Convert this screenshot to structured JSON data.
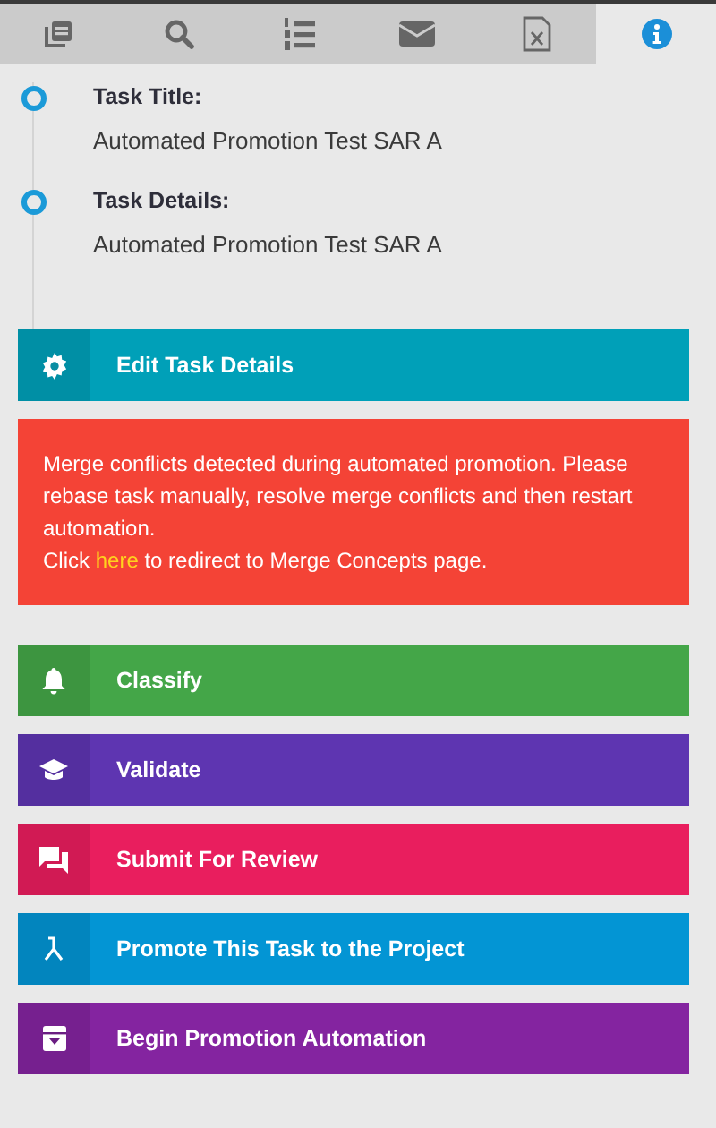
{
  "tabs": [
    {
      "selected": false
    },
    {
      "selected": false
    },
    {
      "selected": false
    },
    {
      "selected": false
    },
    {
      "selected": false
    },
    {
      "selected": true
    }
  ],
  "timeline": [
    {
      "label": "Task Title:",
      "value": "Automated Promotion Test SAR A"
    },
    {
      "label": "Task Details:",
      "value": "Automated Promotion Test SAR A"
    }
  ],
  "edit_button": {
    "label": "Edit Task Details",
    "color": "#00a0b8"
  },
  "alert": {
    "message": "Merge conflicts detected during automated promotion. Please rebase task manually, resolve merge conflicts and then restart automation.",
    "link_before": "Click",
    "link": "here",
    "link_after": "to redirect to Merge Concepts page."
  },
  "actions": [
    {
      "label": "Classify",
      "color": "#44a648"
    },
    {
      "label": "Validate",
      "color": "#5e35b1"
    },
    {
      "label": "Submit For Review",
      "color": "#e91e5e"
    },
    {
      "label": "Promote This Task to the Project",
      "color": "#0395d4"
    },
    {
      "label": "Begin Promotion Automation",
      "color": "#8424a0"
    }
  ]
}
